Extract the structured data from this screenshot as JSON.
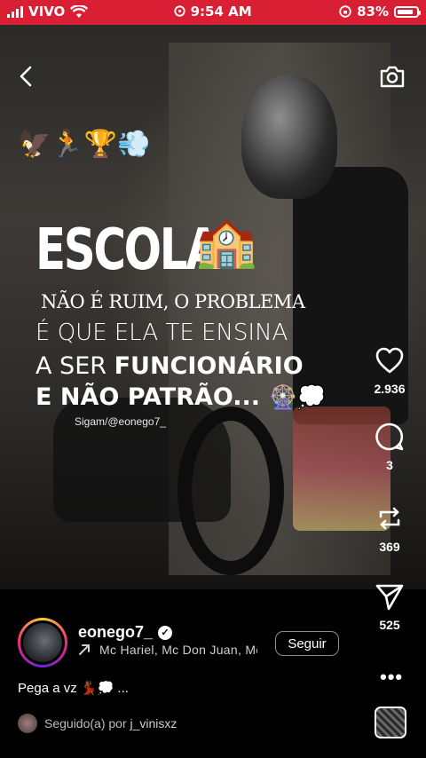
{
  "status_bar": {
    "carrier": "VIVO",
    "time": "9:54 AM",
    "battery": "83%",
    "battery_level": 0.83
  },
  "video": {
    "overlay_title": "ESCOLA",
    "overlay_line1": "NÃO É RUIM, O PROBLEMA",
    "overlay_line2": "É QUE ELA TE ENSINA",
    "overlay_line3_regular": "A  SER ",
    "overlay_line3_bold": "FUNCIONÁRIO",
    "overlay_line4": "E NÃO PATRÃO...",
    "overlay_line4_emoji": "🎡💭",
    "credit": "Sigam/@eonego7_",
    "emoji_cluster": "🦅🏃🏆💨",
    "school_emoji": "🏫"
  },
  "actions": {
    "likes": "2.936",
    "comments": "3",
    "reposts": "369",
    "shares": "525"
  },
  "post": {
    "username": "eonego7_",
    "verified_mark": "✓",
    "music": "Mc Hariel, Mc Don Juan, Mc",
    "follow_label": "Seguir",
    "caption": "Pega a vz 💃🏾💭 ...",
    "followed_by_prefix": "Seguido(a) por ",
    "followed_by_user": "j_vinisxz"
  },
  "colors": {
    "status_bar": "#d91f33",
    "background": "#000000"
  }
}
